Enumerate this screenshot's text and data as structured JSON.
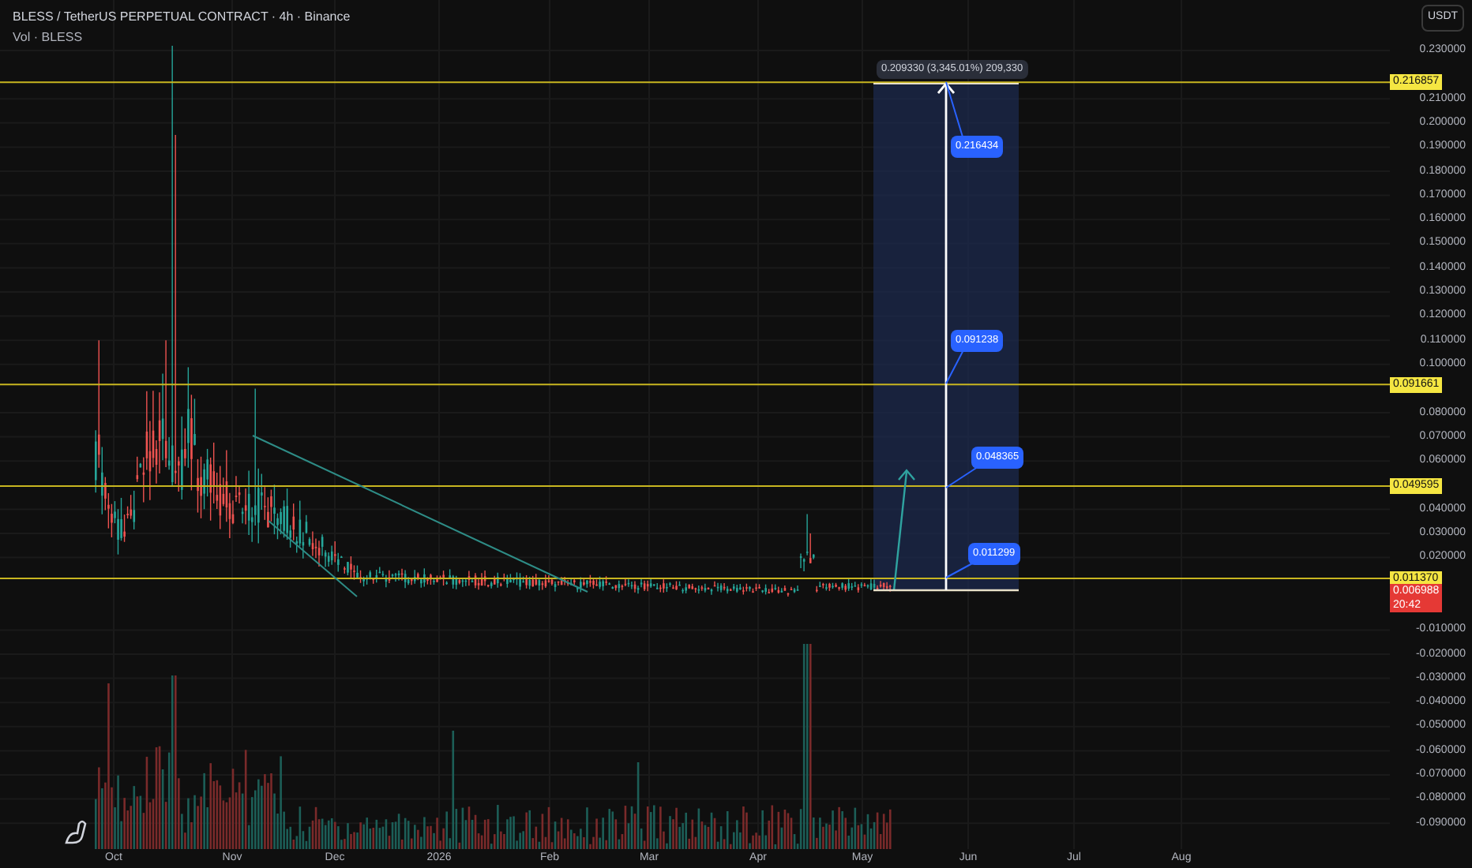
{
  "header": {
    "title": "BLESS / TetherUS PERPETUAL CONTRACT · 4h · Binance",
    "volume_legend": "Vol · BLESS"
  },
  "currency_button": "USDT",
  "price_axis": [
    "0.230000",
    "0.210000",
    "0.200000",
    "0.190000",
    "0.180000",
    "0.170000",
    "0.160000",
    "0.150000",
    "0.140000",
    "0.130000",
    "0.120000",
    "0.110000",
    "0.100000",
    "0.080000",
    "0.070000",
    "0.060000",
    "0.040000",
    "0.030000",
    "0.020000",
    "-0.010000",
    "-0.020000",
    "-0.030000",
    "-0.040000",
    "-0.050000",
    "-0.060000",
    "-0.070000",
    "-0.080000",
    "-0.090000"
  ],
  "time_axis": [
    "Oct",
    "Nov",
    "Dec",
    "2026",
    "Feb",
    "Mar",
    "Apr",
    "May",
    "Jun",
    "Jul",
    "Aug"
  ],
  "levels": [
    {
      "label": "0.216857"
    },
    {
      "label": "0.091661"
    },
    {
      "label": "0.049595"
    },
    {
      "label": "0.011370"
    }
  ],
  "current_price": {
    "price": "0.006988",
    "countdown": "20:42"
  },
  "projection": {
    "headline": "0.209330 (3,345.01%) 209,330",
    "targets": [
      {
        "label": "0.216434"
      },
      {
        "label": "0.091238"
      },
      {
        "label": "0.048365"
      },
      {
        "label": "0.011299"
      }
    ]
  }
}
